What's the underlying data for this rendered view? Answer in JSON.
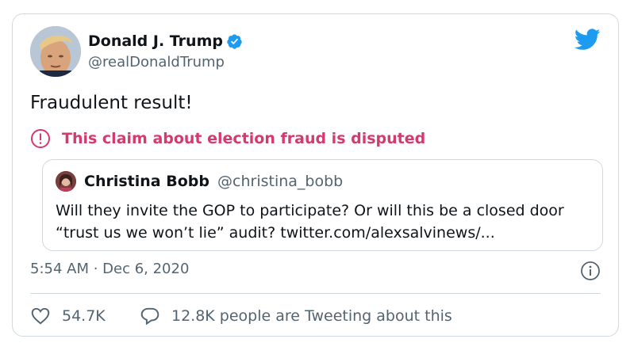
{
  "author": {
    "name": "Donald J. Trump",
    "handle": "@realDonaldTrump"
  },
  "tweet": {
    "text": "Fraudulent result!",
    "warning": "This claim about election fraud is disputed",
    "timestamp": "5:54 AM · Dec 6, 2020"
  },
  "quote": {
    "name": "Christina Bobb",
    "handle": "@christina_bobb",
    "text": "Will they invite the GOP to participate?  Or will this be a closed door “trust us we won’t lie” audit? twitter.com/alexsalvinews/..."
  },
  "actions": {
    "likes": "54.7K",
    "reply_text": "12.8K people are Tweeting about this"
  },
  "colors": {
    "brand": "#1d9bf0",
    "warning": "#d43a6b",
    "secondary_text": "#536471",
    "border": "#cfd9de"
  },
  "icons": [
    "verified-badge-icon",
    "twitter-bird-icon",
    "warning-circle-icon",
    "info-icon",
    "heart-icon",
    "speech-bubble-icon"
  ]
}
